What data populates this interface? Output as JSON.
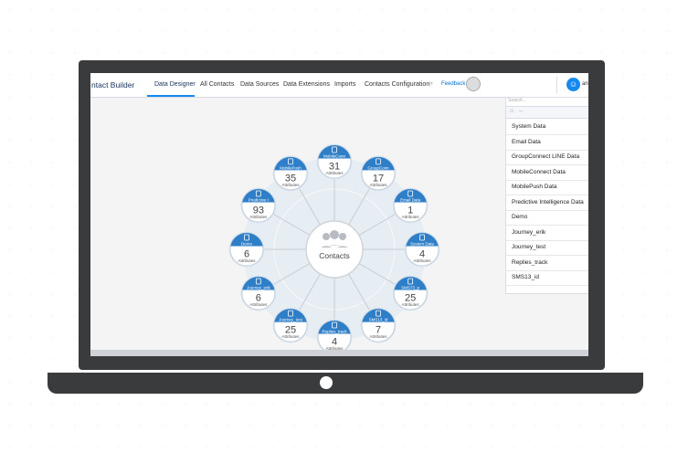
{
  "app": {
    "title": "ntact Builder"
  },
  "nav": {
    "tabs": [
      {
        "label": "Data Designer",
        "active": true
      },
      {
        "label": "All Contacts"
      },
      {
        "label": "Data Sources"
      },
      {
        "label": "Data Extensions"
      },
      {
        "label": "Imports"
      },
      {
        "label": "Contacts Configuration"
      }
    ],
    "separator": "»",
    "feedback": "Feedback",
    "user_initial": "☺",
    "user_name": "an"
  },
  "diagram": {
    "center_label": "Contacts",
    "attributes_label": "Attributes",
    "nodes": [
      {
        "label": "MobileConn",
        "count": "31",
        "icon": "phone-icon"
      },
      {
        "label": "GroupConn",
        "count": "17",
        "icon": "phone-icon"
      },
      {
        "label": "Email Data",
        "count": "1",
        "icon": "envelope-icon"
      },
      {
        "label": "System Data",
        "count": "4",
        "icon": "people-icon"
      },
      {
        "label": "SMS73_p",
        "count": "25",
        "icon": "person-icon"
      },
      {
        "label": "SMS13_id",
        "count": "7",
        "icon": "person-icon"
      },
      {
        "label": "Replies_track",
        "count": "4",
        "icon": "person-icon"
      },
      {
        "label": "Journey_test",
        "count": "25",
        "icon": "person-icon"
      },
      {
        "label": "Journey_erik",
        "count": "6",
        "icon": "person-icon"
      },
      {
        "label": "Demo",
        "count": "6",
        "icon": "stack-icon"
      },
      {
        "label": "Predictive I",
        "count": "93",
        "icon": "cart-icon"
      },
      {
        "label": "MobilePush",
        "count": "35",
        "icon": "phone-icon"
      }
    ]
  },
  "panel": {
    "search_placeholder": "Search...",
    "items": [
      "System Data",
      "Email Data",
      "GroupConnect LINE Data",
      "MobileConnect Data",
      "MobilePush Data",
      "Predictive Intelligence Data",
      "Demo",
      "Journey_erik",
      "Journey_test",
      "Replies_track",
      "SMS13_id"
    ]
  },
  "colors": {
    "accent": "#1589ee",
    "node_header": "#2f7fc8",
    "ring": "#dce9f3"
  }
}
